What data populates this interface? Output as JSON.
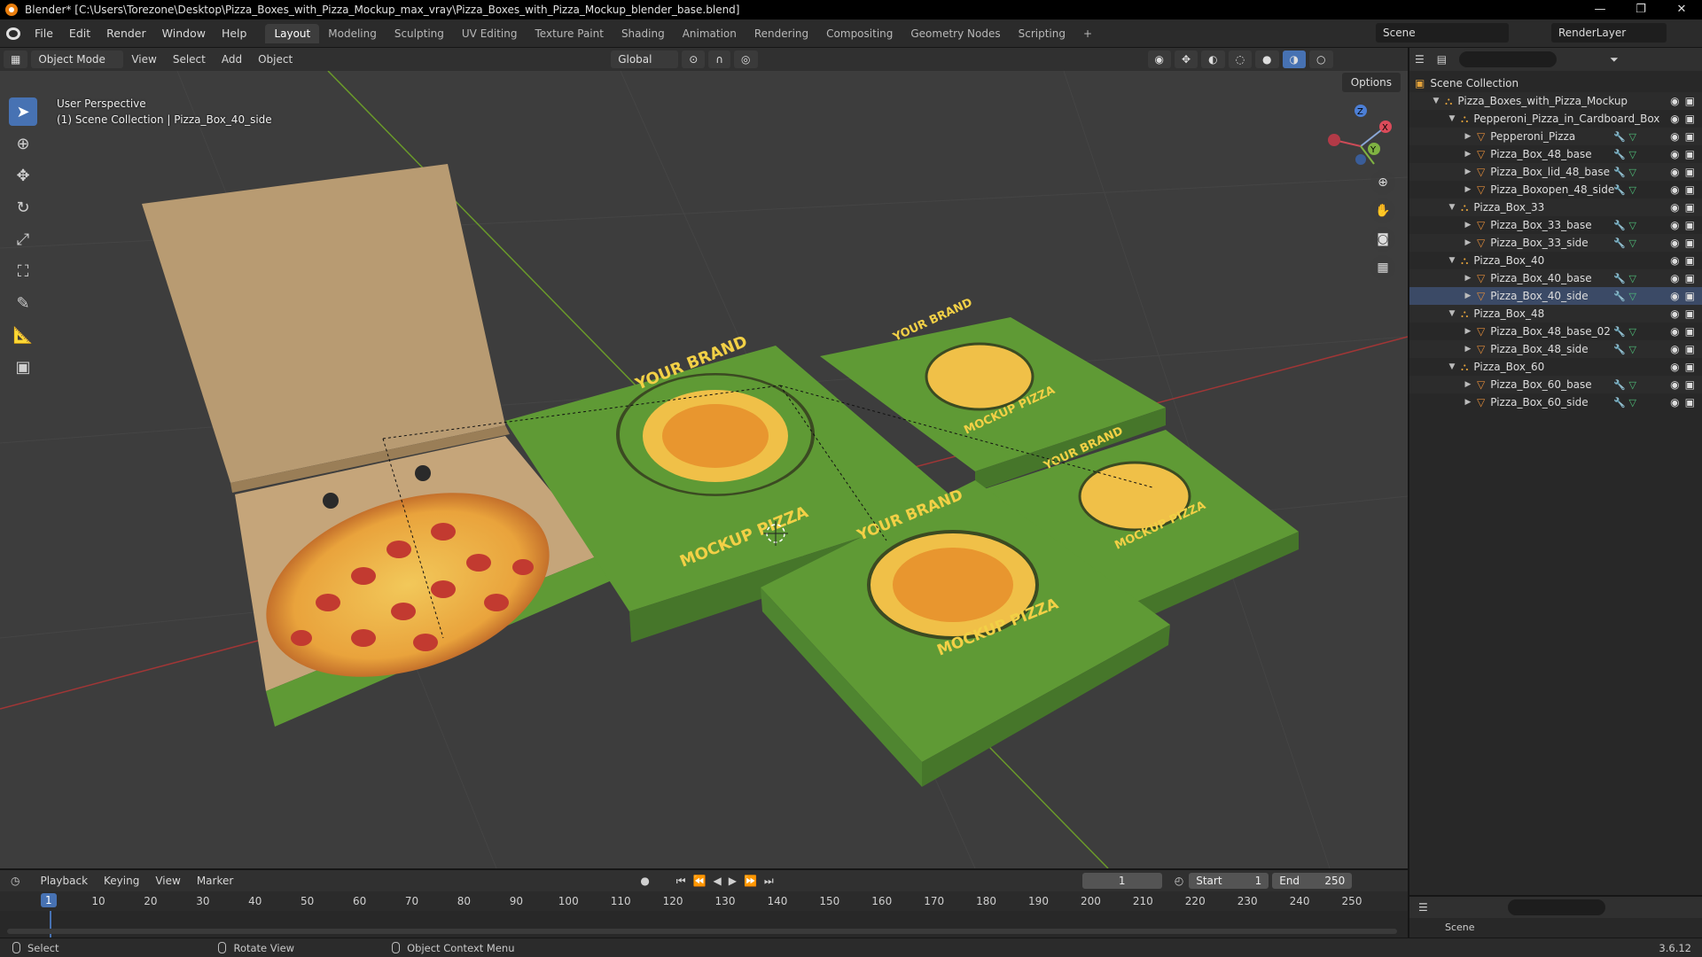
{
  "window": {
    "title": "Blender* [C:\\Users\\Torezone\\Desktop\\Pizza_Boxes_with_Pizza_Mockup_max_vray\\Pizza_Boxes_with_Pizza_Mockup_blender_base.blend]",
    "minimize": "—",
    "restore": "❐",
    "close": "✕"
  },
  "menu": [
    "File",
    "Edit",
    "Render",
    "Window",
    "Help"
  ],
  "workspaces": [
    "Layout",
    "Modeling",
    "Sculpting",
    "UV Editing",
    "Texture Paint",
    "Shading",
    "Animation",
    "Rendering",
    "Compositing",
    "Geometry Nodes",
    "Scripting"
  ],
  "add_workspace": "+",
  "scene": {
    "label": "Scene",
    "render_layer": "RenderLayer"
  },
  "viewport_header": {
    "mode": "Object Mode",
    "menus": [
      "View",
      "Select",
      "Add",
      "Object"
    ],
    "transform": "Global",
    "options": "Options"
  },
  "viewport": {
    "perspective": "User Perspective",
    "context": "(1) Scene Collection | Pizza_Box_40_side",
    "brand_top": "YOUR BRAND",
    "brand_bottom": "MOCKUP PIZZA",
    "gizmo": {
      "x": "X",
      "y": "Y",
      "z": "Z"
    }
  },
  "outliner": {
    "root": "Scene Collection",
    "rows": [
      {
        "label": "Pizza_Boxes_with_Pizza_Mockup",
        "depth": 1,
        "type": "coll",
        "expanded": true
      },
      {
        "label": "Pepperoni_Pizza_in_Cardboard_Box",
        "depth": 2,
        "type": "coll",
        "expanded": true
      },
      {
        "label": "Pepperoni_Pizza",
        "depth": 3,
        "type": "mesh"
      },
      {
        "label": "Pizza_Box_48_base",
        "depth": 3,
        "type": "mesh"
      },
      {
        "label": "Pizza_Box_lid_48_base",
        "depth": 3,
        "type": "mesh"
      },
      {
        "label": "Pizza_Boxopen_48_side",
        "depth": 3,
        "type": "mesh"
      },
      {
        "label": "Pizza_Box_33",
        "depth": 2,
        "type": "coll",
        "expanded": true
      },
      {
        "label": "Pizza_Box_33_base",
        "depth": 3,
        "type": "mesh"
      },
      {
        "label": "Pizza_Box_33_side",
        "depth": 3,
        "type": "mesh"
      },
      {
        "label": "Pizza_Box_40",
        "depth": 2,
        "type": "coll",
        "expanded": true
      },
      {
        "label": "Pizza_Box_40_base",
        "depth": 3,
        "type": "mesh"
      },
      {
        "label": "Pizza_Box_40_side",
        "depth": 3,
        "type": "mesh",
        "selected": true
      },
      {
        "label": "Pizza_Box_48",
        "depth": 2,
        "type": "coll",
        "expanded": true
      },
      {
        "label": "Pizza_Box_48_base_02",
        "depth": 3,
        "type": "mesh"
      },
      {
        "label": "Pizza_Box_48_side",
        "depth": 3,
        "type": "mesh"
      },
      {
        "label": "Pizza_Box_60",
        "depth": 2,
        "type": "coll",
        "expanded": true
      },
      {
        "label": "Pizza_Box_60_base",
        "depth": 3,
        "type": "mesh"
      },
      {
        "label": "Pizza_Box_60_side",
        "depth": 3,
        "type": "mesh"
      }
    ]
  },
  "properties": {
    "scene_label": "Scene"
  },
  "timeline": {
    "menus": [
      "Playback",
      "Keying",
      "View",
      "Marker"
    ],
    "current_frame": "1",
    "start_label": "Start",
    "start": "1",
    "end_label": "End",
    "end": "250",
    "ticks": [
      "10",
      "20",
      "30",
      "40",
      "50",
      "60",
      "70",
      "80",
      "90",
      "100",
      "110",
      "120",
      "130",
      "140",
      "150",
      "160",
      "170",
      "180",
      "190",
      "200",
      "210",
      "220",
      "230",
      "240",
      "250"
    ],
    "playhead": "1"
  },
  "status": {
    "select": "Select",
    "rotate": "Rotate View",
    "context_menu": "Object Context Menu",
    "version": "3.6.12"
  },
  "colors": {
    "accent": "#4772b3",
    "box_green": "#5f9a35",
    "cardboard": "#b89b72"
  }
}
